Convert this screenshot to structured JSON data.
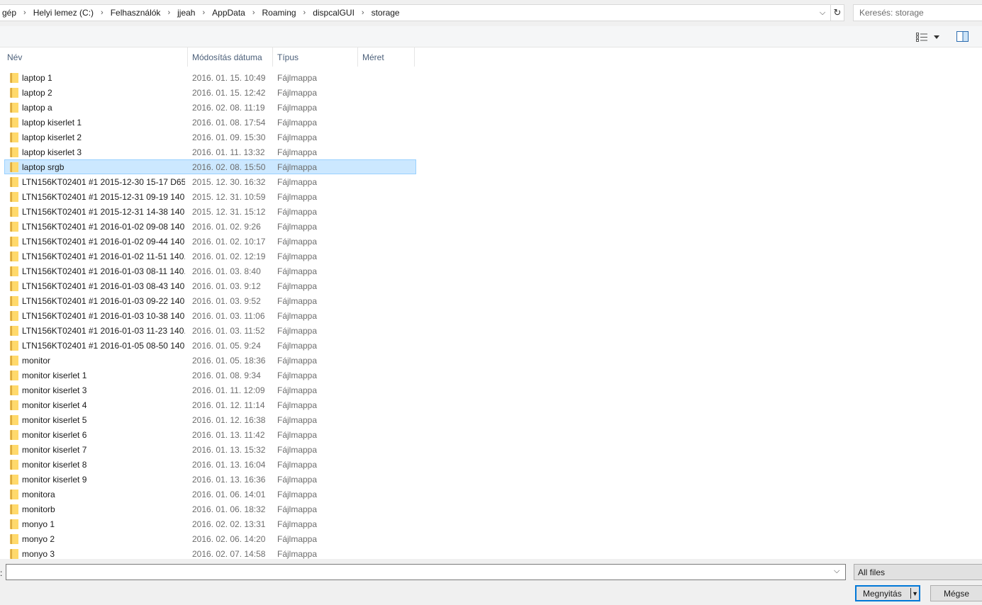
{
  "breadcrumb": [
    "gép",
    "Helyi lemez (C:)",
    "Felhasználók",
    "jjeah",
    "AppData",
    "Roaming",
    "dispcalGUI",
    "storage"
  ],
  "search": {
    "placeholder": "Keresés: storage"
  },
  "columns": {
    "name": "Név",
    "date": "Módosítás dátuma",
    "type": "Típus",
    "size": "Méret"
  },
  "files": [
    {
      "name": "laptop 1",
      "date": "2016. 01. 15. 10:49",
      "type": "Fájlmappa"
    },
    {
      "name": "laptop 2",
      "date": "2016. 01. 15. 12:42",
      "type": "Fájlmappa"
    },
    {
      "name": "laptop a",
      "date": "2016. 02. 08. 11:19",
      "type": "Fájlmappa"
    },
    {
      "name": "laptop kiserlet 1",
      "date": "2016. 01. 08. 17:54",
      "type": "Fájlmappa"
    },
    {
      "name": "laptop kiserlet 2",
      "date": "2016. 01. 09. 15:30",
      "type": "Fájlmappa"
    },
    {
      "name": "laptop kiserlet 3",
      "date": "2016. 01. 11. 13:32",
      "type": "Fájlmappa"
    },
    {
      "name": "laptop srgb",
      "date": "2016. 02. 08. 15:50",
      "type": "Fájlmappa",
      "selected": true
    },
    {
      "name": "LTN156KT02401 #1 2015-12-30 15-17 D65...",
      "date": "2015. 12. 30. 16:32",
      "type": "Fájlmappa"
    },
    {
      "name": "LTN156KT02401 #1 2015-12-31 09-19 140...",
      "date": "2015. 12. 31. 10:59",
      "type": "Fájlmappa"
    },
    {
      "name": "LTN156KT02401 #1 2015-12-31 14-38 140...",
      "date": "2015. 12. 31. 15:12",
      "type": "Fájlmappa"
    },
    {
      "name": "LTN156KT02401 #1 2016-01-02 09-08 140...",
      "date": "2016. 01. 02. 9:26",
      "type": "Fájlmappa"
    },
    {
      "name": "LTN156KT02401 #1 2016-01-02 09-44 140...",
      "date": "2016. 01. 02. 10:17",
      "type": "Fájlmappa"
    },
    {
      "name": "LTN156KT02401 #1 2016-01-02 11-51 140...",
      "date": "2016. 01. 02. 12:19",
      "type": "Fájlmappa"
    },
    {
      "name": "LTN156KT02401 #1 2016-01-03 08-11 140...",
      "date": "2016. 01. 03. 8:40",
      "type": "Fájlmappa"
    },
    {
      "name": "LTN156KT02401 #1 2016-01-03 08-43 140...",
      "date": "2016. 01. 03. 9:12",
      "type": "Fájlmappa"
    },
    {
      "name": "LTN156KT02401 #1 2016-01-03 09-22 140...",
      "date": "2016. 01. 03. 9:52",
      "type": "Fájlmappa"
    },
    {
      "name": "LTN156KT02401 #1 2016-01-03 10-38 140...",
      "date": "2016. 01. 03. 11:06",
      "type": "Fájlmappa"
    },
    {
      "name": "LTN156KT02401 #1 2016-01-03 11-23 140...",
      "date": "2016. 01. 03. 11:52",
      "type": "Fájlmappa"
    },
    {
      "name": "LTN156KT02401 #1 2016-01-05 08-50 140...",
      "date": "2016. 01. 05. 9:24",
      "type": "Fájlmappa"
    },
    {
      "name": "monitor",
      "date": "2016. 01. 05. 18:36",
      "type": "Fájlmappa"
    },
    {
      "name": "monitor kiserlet 1",
      "date": "2016. 01. 08. 9:34",
      "type": "Fájlmappa"
    },
    {
      "name": "monitor kiserlet 3",
      "date": "2016. 01. 11. 12:09",
      "type": "Fájlmappa"
    },
    {
      "name": "monitor kiserlet 4",
      "date": "2016. 01. 12. 11:14",
      "type": "Fájlmappa"
    },
    {
      "name": "monitor kiserlet 5",
      "date": "2016. 01. 12. 16:38",
      "type": "Fájlmappa"
    },
    {
      "name": "monitor kiserlet 6",
      "date": "2016. 01. 13. 11:42",
      "type": "Fájlmappa"
    },
    {
      "name": "monitor kiserlet 7",
      "date": "2016. 01. 13. 15:32",
      "type": "Fájlmappa"
    },
    {
      "name": "monitor kiserlet 8",
      "date": "2016. 01. 13. 16:04",
      "type": "Fájlmappa"
    },
    {
      "name": "monitor kiserlet 9",
      "date": "2016. 01. 13. 16:36",
      "type": "Fájlmappa"
    },
    {
      "name": "monitora",
      "date": "2016. 01. 06. 14:01",
      "type": "Fájlmappa"
    },
    {
      "name": "monitorb",
      "date": "2016. 01. 06. 18:32",
      "type": "Fájlmappa"
    },
    {
      "name": "monyo 1",
      "date": "2016. 02. 02. 13:31",
      "type": "Fájlmappa"
    },
    {
      "name": "monyo 2",
      "date": "2016. 02. 06. 14:20",
      "type": "Fájlmappa"
    },
    {
      "name": "monyo 3",
      "date": "2016. 02. 07. 14:58",
      "type": "Fájlmappa"
    }
  ],
  "bottom": {
    "filename_label": ":",
    "filename_value": "",
    "filetype": "All files",
    "open_label": "Megnyitás",
    "cancel_label": "Mégse"
  },
  "icons": {
    "folder": "folder-icon",
    "breadcrumb_sep": "chevron-right-icon",
    "refresh": "refresh-icon",
    "view": "view-options-icon",
    "preview": "preview-pane-icon"
  },
  "colors": {
    "selection_bg": "#cce8ff",
    "selection_border": "#99d1ff",
    "accent": "#0078d7",
    "folder": "#ffd96b"
  }
}
